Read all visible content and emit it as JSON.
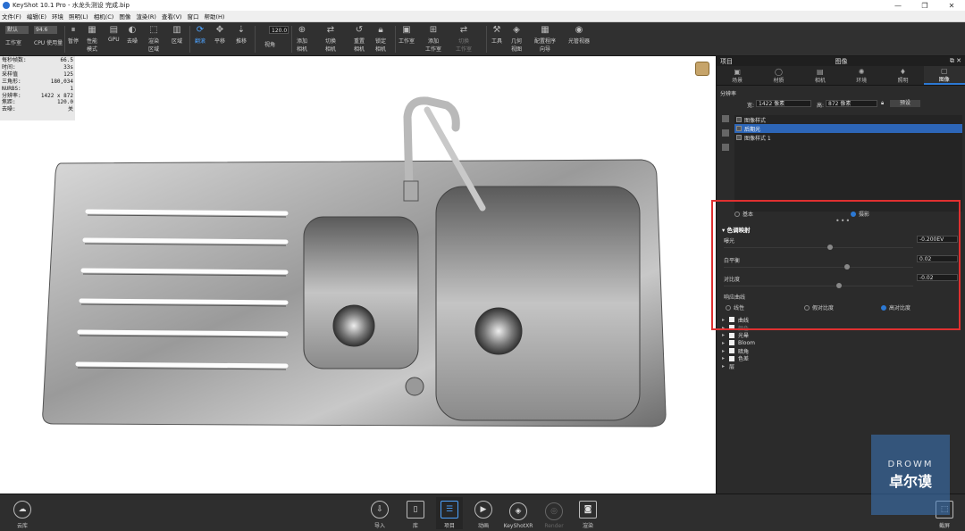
{
  "window": {
    "title": "KeyShot 10.1 Pro  - 水龙头测设 完成.bip"
  },
  "menu": [
    "文件(F)",
    "编辑(E)",
    "环境",
    "照明(L)",
    "相机(C)",
    "图像",
    "渲染(R)",
    "查看(V)",
    "窗口",
    "帮助(H)"
  ],
  "ribbon": {
    "workspace_select": "默认",
    "cpu_value": "94.6",
    "cpu_label": "CPU 使用量",
    "pause": "暂停",
    "perf_mode": "性能\n模式",
    "gpu": "GPU",
    "denoise": "去噪",
    "region": "渲染\n区域",
    "backplate": "区域",
    "turntable": "翻滚",
    "pan": "平移",
    "dolly": "推移",
    "fov_value": "120.0",
    "fov_label": "视角",
    "add_camera": "添加\n相机",
    "switch_camera": "切换\n相机",
    "reset_camera": "重置\n相机",
    "lock_camera": "锁定\n相机",
    "workspace": "工作室",
    "add_workspace": "添加\n工作室",
    "switch_workspace": "切换\n工作室",
    "tools": "工具",
    "geometry_view": "几何\n视图",
    "config_wizard": "配置程序\n向导",
    "lux_render": "光管视器"
  },
  "stats": [
    {
      "k": "每秒帧数:",
      "v": "66.5"
    },
    {
      "k": "时间:",
      "v": "33s"
    },
    {
      "k": "采样值",
      "v": "125"
    },
    {
      "k": "三角形:",
      "v": "180,034"
    },
    {
      "k": "NURBS:",
      "v": "1"
    },
    {
      "k": "分辨率:",
      "v": "1422 x 872"
    },
    {
      "k": "焦距:",
      "v": "120.0"
    },
    {
      "k": "去噪:",
      "v": "关"
    }
  ],
  "panel": {
    "left_title": "项目",
    "title": "图像",
    "tabs": [
      {
        "label": "场景",
        "icon": "▣"
      },
      {
        "label": "材质",
        "icon": "◯"
      },
      {
        "label": "相机",
        "icon": "▤"
      },
      {
        "label": "环境",
        "icon": "✺"
      },
      {
        "label": "照明",
        "icon": "♦"
      },
      {
        "label": "图像",
        "icon": "▢"
      }
    ],
    "resolution_label": "分辨率",
    "width_label": "宽:",
    "width_value": "1422 像素",
    "height_label": "高:",
    "height_value": "872 像素",
    "preset_label": "预设",
    "styles_header": "图像样式",
    "styles": [
      "后期光",
      "图像样式 1"
    ],
    "mode_basic": "基本",
    "mode_photo": "摄影",
    "tone_header": "色调映射",
    "params": [
      {
        "label": "曝光",
        "value": "-0.200EV",
        "pos": 0.56
      },
      {
        "label": "白平衡",
        "value": "0.02",
        "pos": 0.65
      },
      {
        "label": "对比度",
        "value": "-0.02",
        "pos": 0.61
      }
    ],
    "curve_label": "响应曲线",
    "curve_options": [
      "线性",
      "假对比度",
      "高对比度"
    ],
    "tree": [
      {
        "label": "曲线",
        "checked": false
      },
      {
        "label": "颜色",
        "checked": false
      },
      {
        "label": "光晕",
        "checked": false
      },
      {
        "label": "Bloom",
        "checked": false
      },
      {
        "label": "暗角",
        "checked": false
      },
      {
        "label": "色差",
        "checked": false
      },
      {
        "label": "层",
        "checked": false
      }
    ]
  },
  "watermark": {
    "line1": "DROWM",
    "line2": "卓尔谟"
  },
  "bottom": {
    "cloud": "云库",
    "import": "导入",
    "library": "库",
    "project": "项目",
    "animation": "动画",
    "keyshotxr": "KeyShotXR",
    "render_dim": "Render",
    "render": "渲染",
    "screenshot": "截屏"
  }
}
